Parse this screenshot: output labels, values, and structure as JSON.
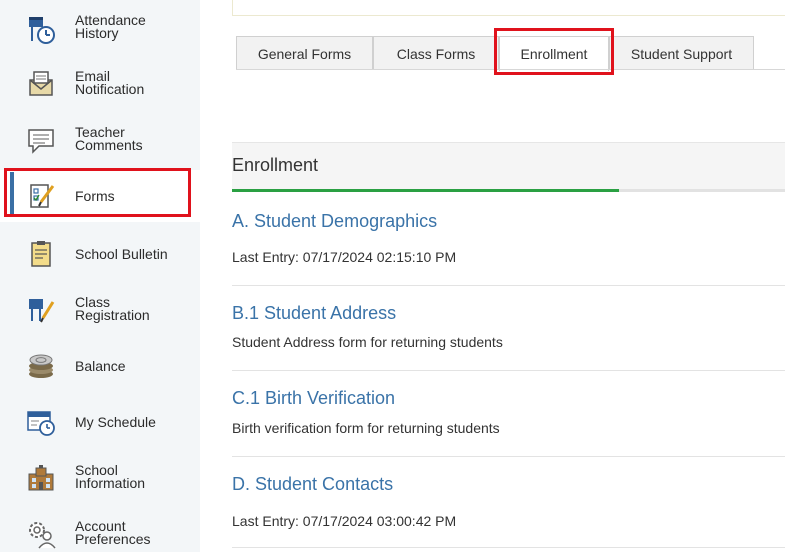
{
  "sidebar": {
    "items": [
      {
        "label": "Attendance\nHistory",
        "icon": "attendance-history-icon"
      },
      {
        "label": "Email\nNotification",
        "icon": "email-notification-icon"
      },
      {
        "label": "Teacher\nComments",
        "icon": "teacher-comments-icon"
      },
      {
        "label": "Forms",
        "icon": "forms-icon",
        "active": true
      },
      {
        "label": "School Bulletin",
        "icon": "school-bulletin-icon"
      },
      {
        "label": "Class\nRegistration",
        "icon": "class-registration-icon"
      },
      {
        "label": "Balance",
        "icon": "balance-icon"
      },
      {
        "label": "My Schedule",
        "icon": "my-schedule-icon"
      },
      {
        "label": "School\nInformation",
        "icon": "school-information-icon"
      },
      {
        "label": "Account\nPreferences",
        "icon": "account-preferences-icon"
      }
    ]
  },
  "tabs": [
    {
      "label": "General Forms"
    },
    {
      "label": "Class Forms"
    },
    {
      "label": "Enrollment",
      "active": true
    },
    {
      "label": "Student Support"
    }
  ],
  "section": {
    "title": "Enrollment",
    "progress_fraction": 0.7
  },
  "forms": [
    {
      "title": "A. Student Demographics",
      "subtitle": "Last Entry: 07/17/2024 02:15:10 PM"
    },
    {
      "title": "B.1 Student Address",
      "subtitle": "Student Address form for returning students"
    },
    {
      "title": "C.1 Birth Verification",
      "subtitle": "Birth verification form for returning students"
    },
    {
      "title": "D. Student Contacts",
      "subtitle": "Last Entry: 07/17/2024 03:00:42 PM"
    }
  ],
  "colors": {
    "highlight": "#e0121c",
    "link": "#3a73a8",
    "progress": "#2aa043",
    "active_bar": "#3a6fa5"
  }
}
